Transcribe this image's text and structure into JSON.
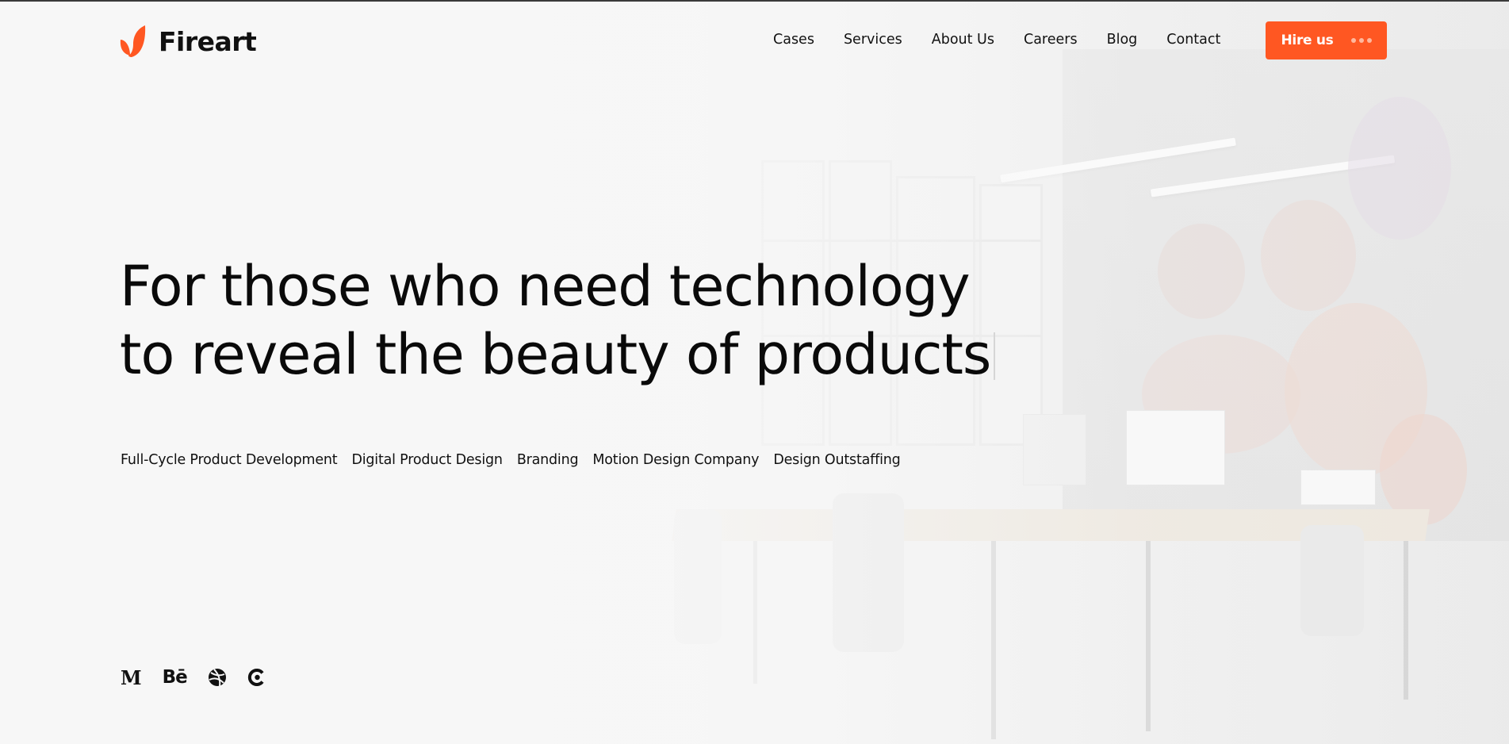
{
  "brand": {
    "name": "Fireart",
    "accent_color": "#ff5722",
    "logo_icon": "flame-leaf-icon"
  },
  "nav": {
    "items": [
      {
        "label": "Cases"
      },
      {
        "label": "Services"
      },
      {
        "label": "About Us"
      },
      {
        "label": "Careers"
      },
      {
        "label": "Blog"
      },
      {
        "label": "Contact"
      }
    ],
    "cta": {
      "label": "Hire us",
      "icon": "three-dots-icon"
    }
  },
  "hero": {
    "title_line1": "For those who need technology",
    "title_line2": "to reveal the beauty of products"
  },
  "services": [
    {
      "label": "Full-Cycle Product Development"
    },
    {
      "label": "Digital Product Design"
    },
    {
      "label": "Branding"
    },
    {
      "label": "Motion Design Company"
    },
    {
      "label": "Design Outstaffing"
    }
  ],
  "social": [
    {
      "name": "medium-icon",
      "glyph": "M"
    },
    {
      "name": "behance-icon",
      "glyph": "Bē"
    },
    {
      "name": "dribbble-icon",
      "glyph": ""
    },
    {
      "name": "clutch-icon",
      "glyph": ""
    }
  ]
}
